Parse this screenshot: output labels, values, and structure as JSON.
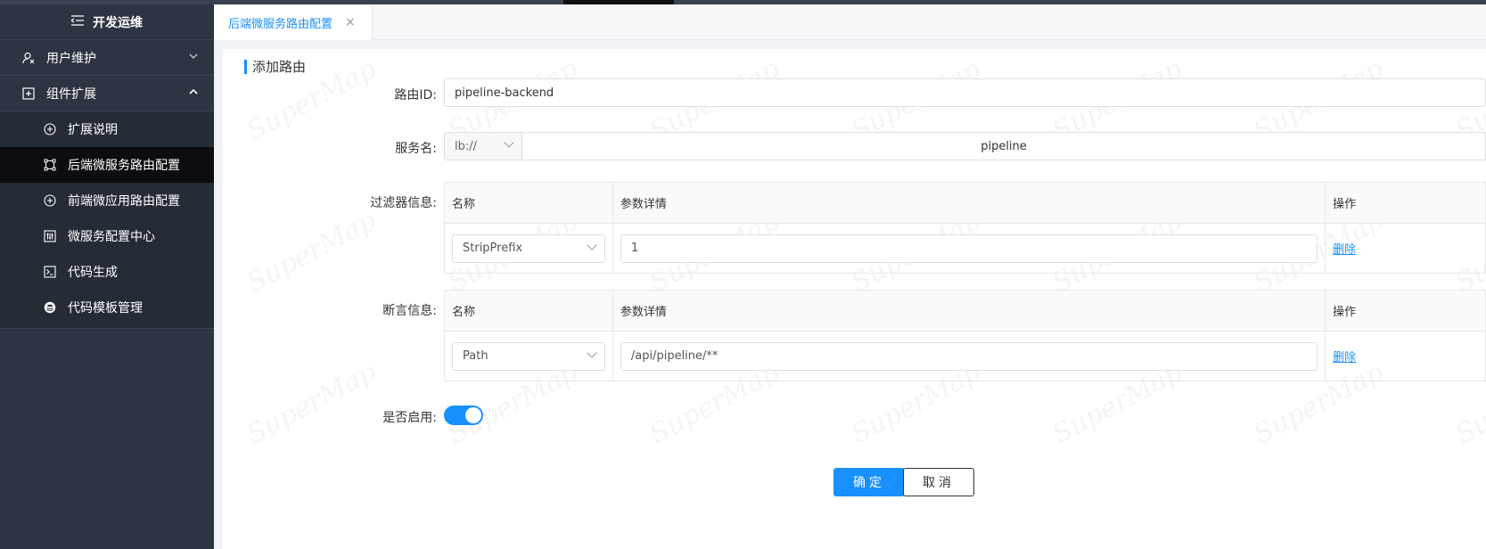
{
  "sidebar": {
    "header": "开发运维",
    "groups": [
      {
        "label": "用户维护",
        "expanded": false
      },
      {
        "label": "组件扩展",
        "expanded": true
      }
    ],
    "items": [
      {
        "label": "扩展说明"
      },
      {
        "label": "后端微服务路由配置",
        "active": true
      },
      {
        "label": "前端微应用路由配置"
      },
      {
        "label": "微服务配置中心"
      },
      {
        "label": "代码生成"
      },
      {
        "label": "代码模板管理"
      }
    ]
  },
  "tab": {
    "label": "后端微服务路由配置",
    "close": "×"
  },
  "form": {
    "title": "添加路由",
    "route_id": {
      "label": "路由ID:",
      "value": "pipeline-backend"
    },
    "service": {
      "label": "服务名:",
      "prefix": "lb://",
      "value": "pipeline"
    },
    "filters": {
      "label": "过滤器信息:",
      "headers": [
        "名称",
        "参数详情",
        "操作"
      ],
      "rows": [
        {
          "name": "StripPrefix",
          "param": "1",
          "action": "删除"
        }
      ]
    },
    "predicates": {
      "label": "断言信息:",
      "headers": [
        "名称",
        "参数详情",
        "操作"
      ],
      "rows": [
        {
          "name": "Path",
          "param": "/api/pipeline/**",
          "action": "删除"
        }
      ]
    },
    "enabled": {
      "label": "是否启用:",
      "value": true
    },
    "confirm": "确定",
    "cancel": "取消"
  },
  "watermark": "SuperMap",
  "colors": {
    "accent": "#1890ff",
    "sidebar": "#2e3542",
    "sidebar_active": "#0b0d10"
  }
}
